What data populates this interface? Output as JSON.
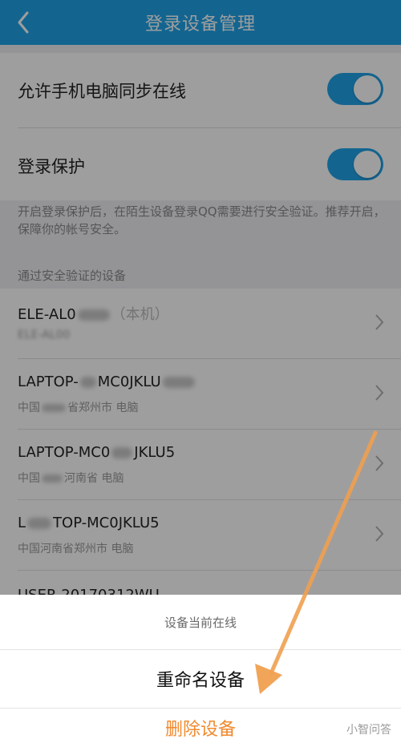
{
  "header": {
    "title": "登录设备管理"
  },
  "settings": {
    "sync_online_label": "允许手机电脑同步在线",
    "login_protect_label": "登录保护",
    "description": "开启登录保护后，在陌生设备登录QQ需要进行安全验证。推荐开启，保障你的帐号安全。",
    "section_title": "通过安全验证的设备"
  },
  "devices": [
    {
      "name": "ELE-AL0",
      "suffix": "（本机）",
      "sub": "ELE-AL00"
    },
    {
      "name": "LAPTOP-",
      "suffix": "MC0JKLU",
      "sub_a": "中国",
      "sub_b": "省郑州市 电脑"
    },
    {
      "name": "LAPTOP-MC0",
      "suffix": "JKLU5",
      "sub_a": "中国",
      "sub_b": "河南省 电脑"
    },
    {
      "name": "L",
      "suffix": "TOP-MC0JKLU5",
      "sub": "中国河南省郑州市 电脑"
    },
    {
      "name": "USER-20170312WU"
    }
  ],
  "sheet": {
    "title": "设备当前在线",
    "rename_label": "重命名设备",
    "delete_label": "删除设备"
  },
  "watermark": "小智问答",
  "colors": {
    "accent": "#1fa3e8",
    "delete": "#f08a2f",
    "arrow": "#f0a050"
  }
}
